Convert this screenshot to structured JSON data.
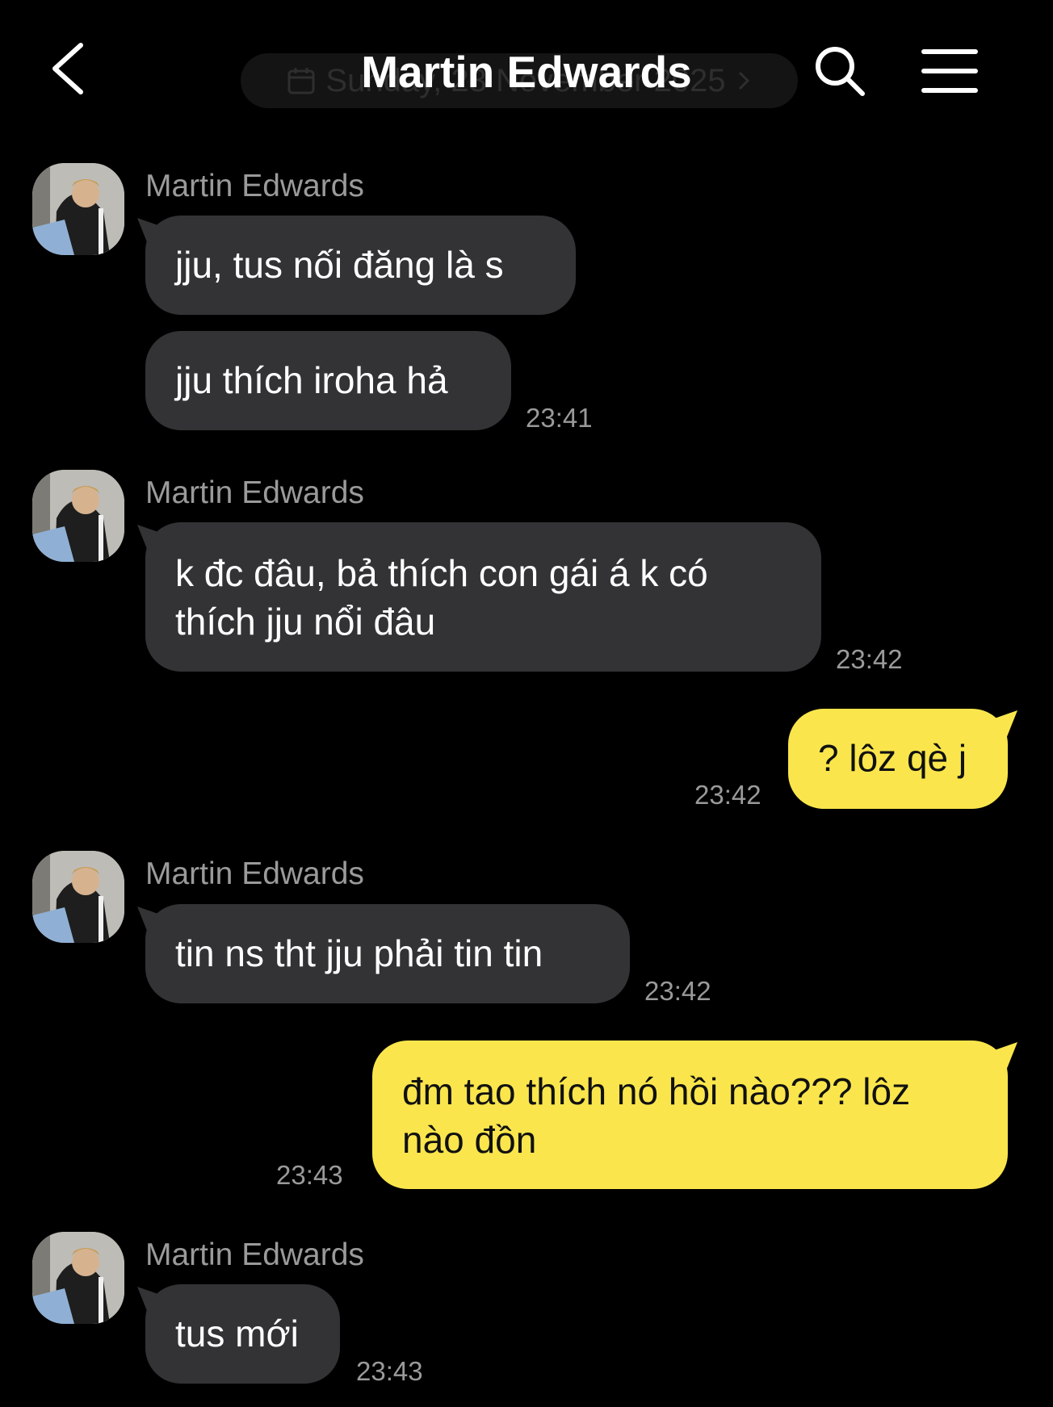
{
  "header": {
    "title": "Martin Edwards",
    "date_label": "Sunday, 23 November 2025",
    "back_icon": "chevron-left-icon",
    "search_icon": "search-icon",
    "menu_icon": "menu-icon"
  },
  "colors": {
    "background": "#000000",
    "incoming_bubble": "#333336",
    "outgoing_bubble": "#fae64c",
    "secondary_text": "#9a9a9a"
  },
  "messages": [
    {
      "direction": "incoming",
      "sender": "Martin Edwards",
      "lines": [
        "jju, tus nối đăng là s"
      ]
    },
    {
      "direction": "incoming",
      "lines": [
        "jju thích iroha hả"
      ],
      "time": "23:41"
    },
    {
      "direction": "incoming",
      "sender": "Martin Edwards",
      "lines": [
        "k đc đâu, bả thích con gái á k có",
        "thích jju nổi đâu"
      ],
      "time": "23:42"
    },
    {
      "direction": "outgoing",
      "lines": [
        "? lôz qè j"
      ],
      "time": "23:42"
    },
    {
      "direction": "incoming",
      "sender": "Martin Edwards",
      "lines": [
        "tin ns tht jju phải tin tin"
      ],
      "time": "23:42"
    },
    {
      "direction": "outgoing",
      "lines": [
        "đm tao thích nó hồi nào??? lôz",
        "nào đồn"
      ],
      "time": "23:43"
    },
    {
      "direction": "incoming",
      "sender": "Martin Edwards",
      "lines": [
        "tus mới"
      ],
      "time": "23:43"
    }
  ]
}
